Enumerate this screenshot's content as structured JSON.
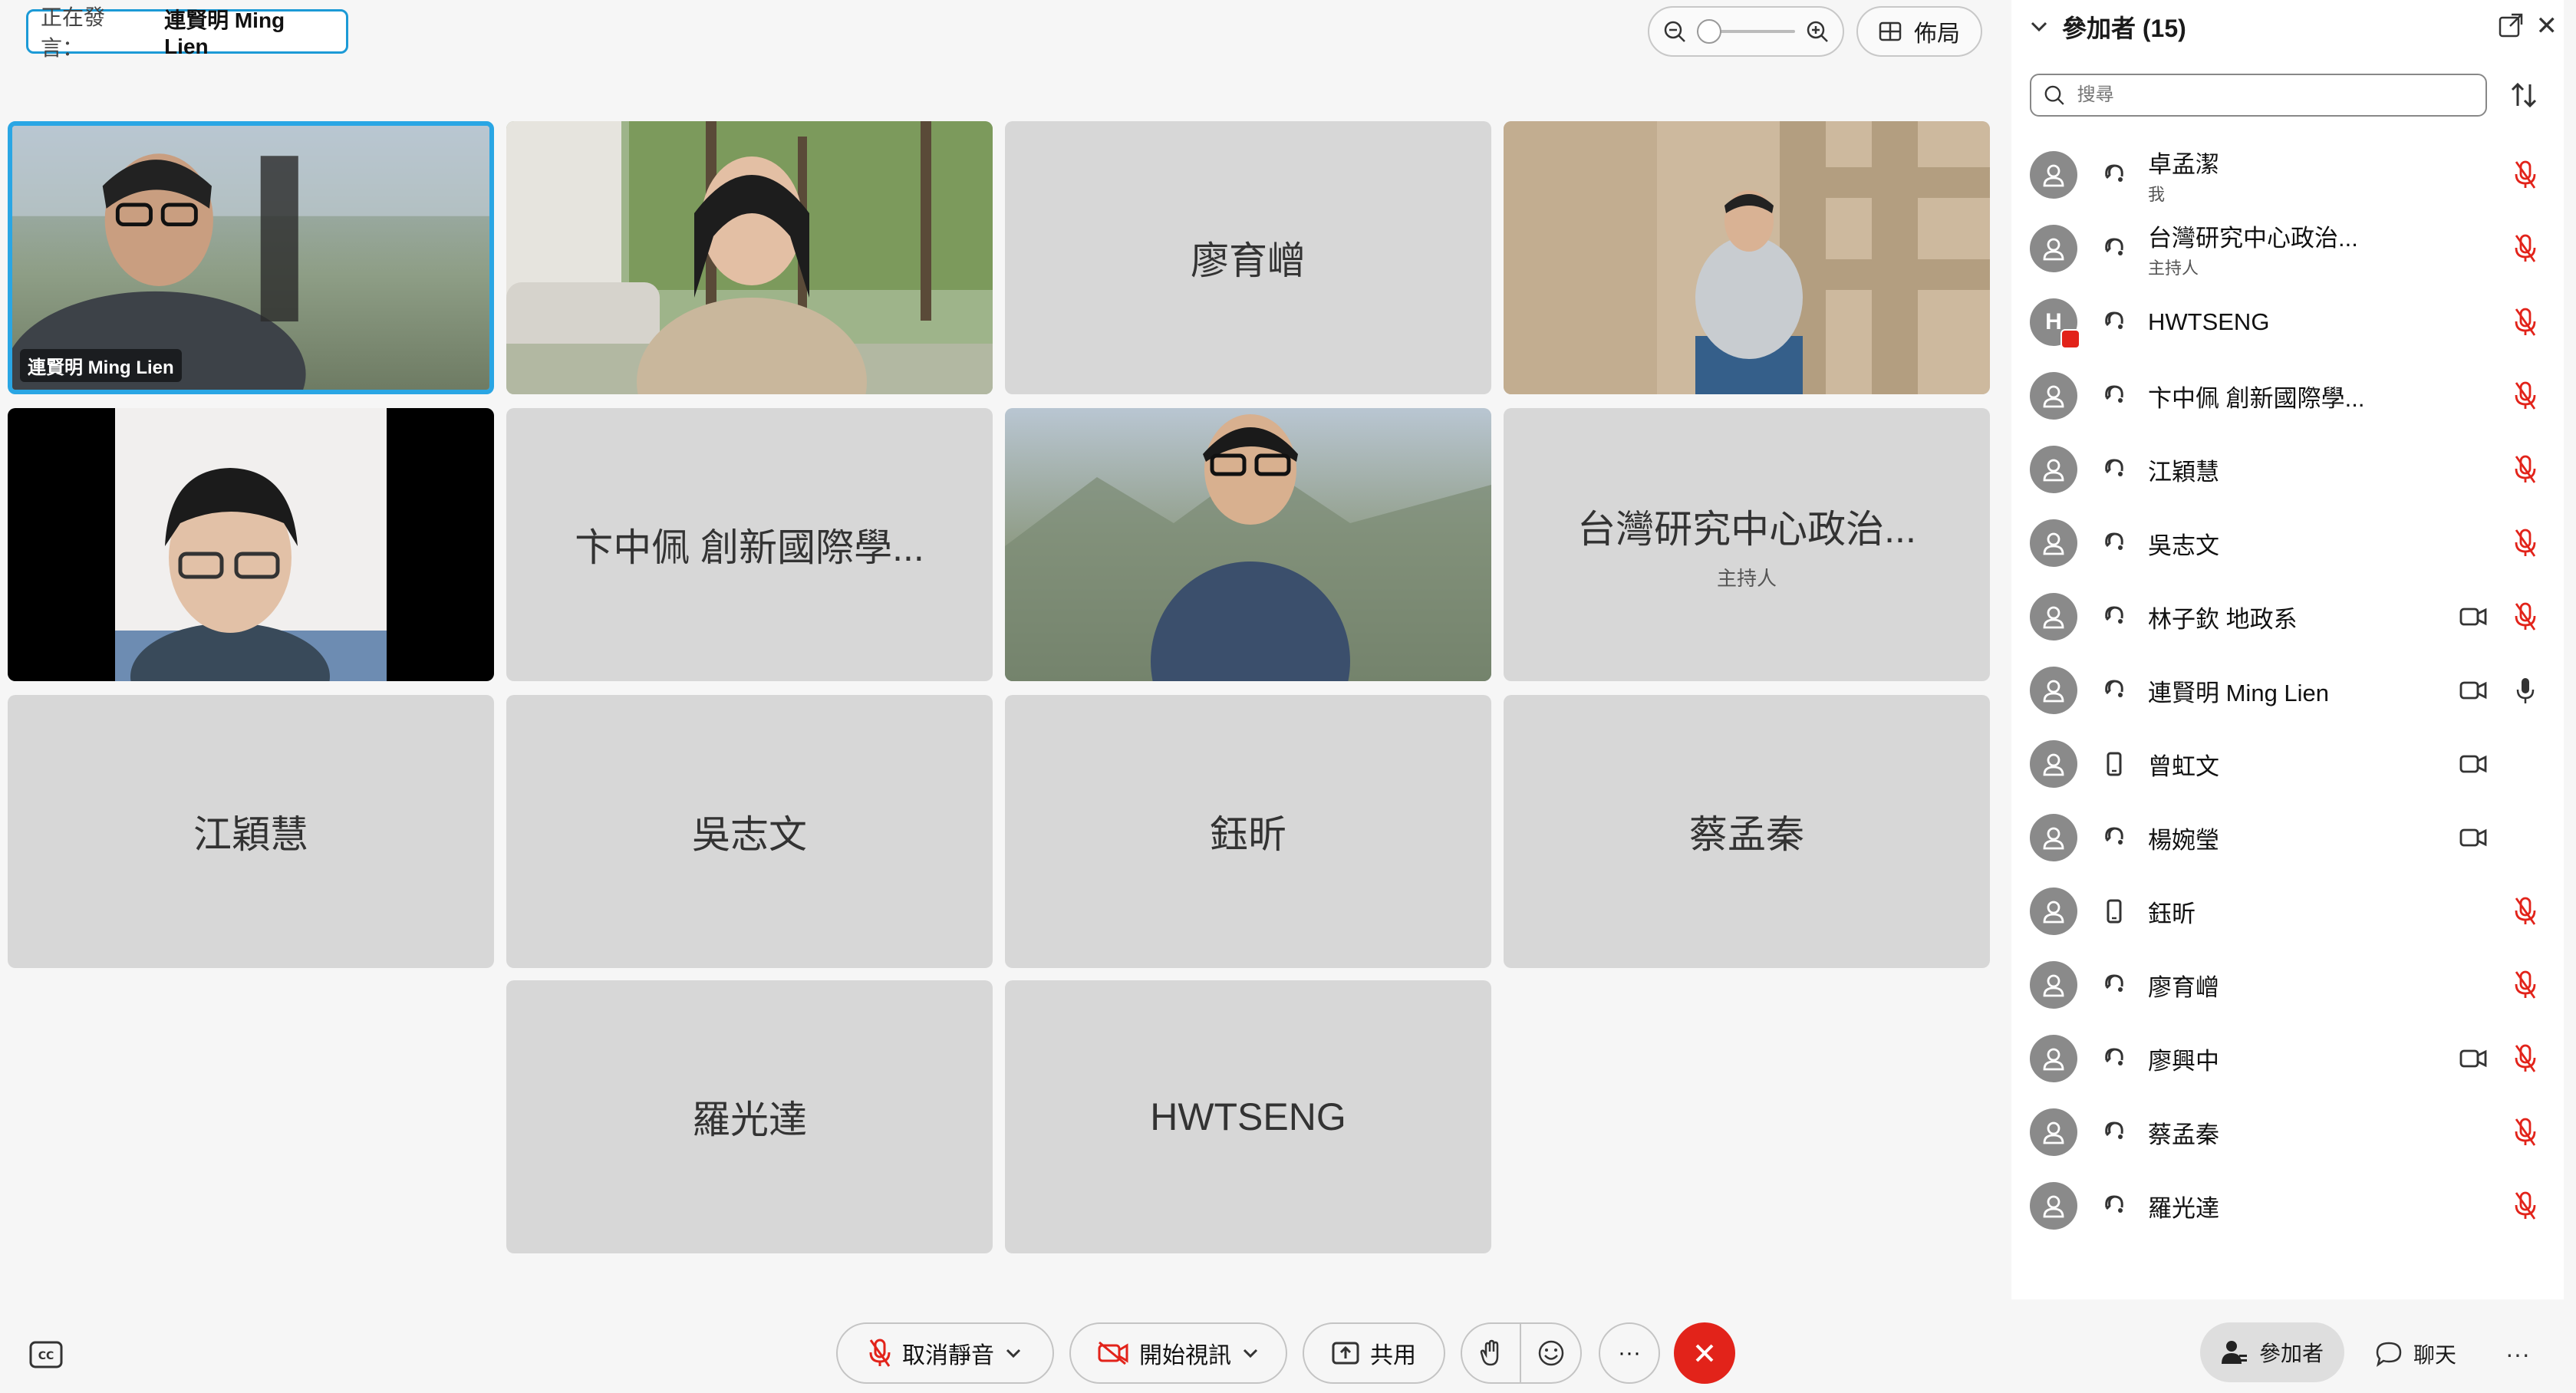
{
  "speaker": {
    "label": "正在發言：",
    "name": "連賢明 Ming Lien"
  },
  "layout_button": {
    "label": "佈局",
    "icon": "grid-icon"
  },
  "zoom": {
    "level": 0.0
  },
  "tiles": [
    {
      "name": "連賢明 Ming Lien",
      "video": true,
      "active": true
    },
    {
      "name": "",
      "video": true
    },
    {
      "name": "廖育嶒",
      "video": false
    },
    {
      "name": "",
      "video": true
    },
    {
      "name": "",
      "video": true
    },
    {
      "name": "卞中佩 創新國際學...",
      "video": false
    },
    {
      "name": "",
      "video": true
    },
    {
      "name": "台灣研究中心政治...",
      "role": "主持人",
      "video": false
    },
    {
      "name": "江穎慧",
      "video": false
    },
    {
      "name": "吳志文",
      "video": false
    },
    {
      "name": "鈺昕",
      "video": false
    },
    {
      "name": "蔡孟秦",
      "video": false
    },
    {
      "name": "羅光達",
      "video": false
    },
    {
      "name": "HWTSENG",
      "video": false
    }
  ],
  "panel": {
    "title": "參加者 (15)",
    "search_placeholder": "搜尋",
    "participants": [
      {
        "name": "卓孟潔",
        "sub": "我",
        "type": "audio",
        "camera": false,
        "mic": "muted"
      },
      {
        "name": "台灣研究中心政治...",
        "sub": "主持人",
        "type": "audio",
        "camera": false,
        "mic": "muted"
      },
      {
        "name": "HWTSENG",
        "sub": "",
        "type": "audio",
        "camera": false,
        "mic": "muted",
        "avatar_letter": "H",
        "sharing": true
      },
      {
        "name": "卞中佩 創新國際學...",
        "sub": "",
        "type": "audio",
        "camera": false,
        "mic": "muted"
      },
      {
        "name": "江穎慧",
        "sub": "",
        "type": "audio",
        "camera": false,
        "mic": "muted"
      },
      {
        "name": "吳志文",
        "sub": "",
        "type": "audio",
        "camera": false,
        "mic": "muted"
      },
      {
        "name": "林子欽 地政系",
        "sub": "",
        "type": "audio",
        "camera": true,
        "mic": "muted"
      },
      {
        "name": "連賢明 Ming Lien",
        "sub": "",
        "type": "audio",
        "camera": true,
        "mic": "active"
      },
      {
        "name": "曾虹文",
        "sub": "",
        "type": "phone",
        "camera": true,
        "mic": "none"
      },
      {
        "name": "楊婉瑩",
        "sub": "",
        "type": "audio",
        "camera": true,
        "mic": "none"
      },
      {
        "name": "鈺昕",
        "sub": "",
        "type": "phone",
        "camera": false,
        "mic": "muted"
      },
      {
        "name": "廖育嶒",
        "sub": "",
        "type": "audio",
        "camera": false,
        "mic": "muted"
      },
      {
        "name": "廖興中",
        "sub": "",
        "type": "audio",
        "camera": true,
        "mic": "muted"
      },
      {
        "name": "蔡孟秦",
        "sub": "",
        "type": "audio",
        "camera": false,
        "mic": "muted"
      },
      {
        "name": "羅光達",
        "sub": "",
        "type": "audio",
        "camera": false,
        "mic": "muted"
      }
    ]
  },
  "toolbar": {
    "unmute": "取消靜音",
    "start_video": "開始視訊",
    "share": "共用",
    "more": "···",
    "participants": "參加者",
    "chat": "聊天",
    "overflow": "···"
  },
  "colors": {
    "accent": "#1c9ad6",
    "danger": "#e2231a",
    "tile_bg": "#d7d7d7"
  }
}
